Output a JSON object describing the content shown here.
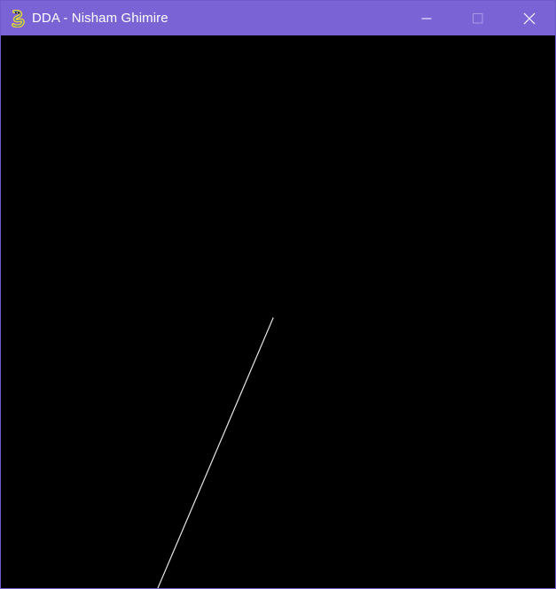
{
  "window": {
    "title": "DDA - Nisham Ghimire",
    "icon": "pygame-snake-icon",
    "controls": {
      "minimize": "minimize-icon",
      "maximize": "maximize-icon",
      "close": "close-icon"
    },
    "colors": {
      "titlebar": "#7a63d4",
      "border": "#6f5bc7",
      "canvas": "#000000",
      "line": "#e6e6e6"
    }
  }
}
